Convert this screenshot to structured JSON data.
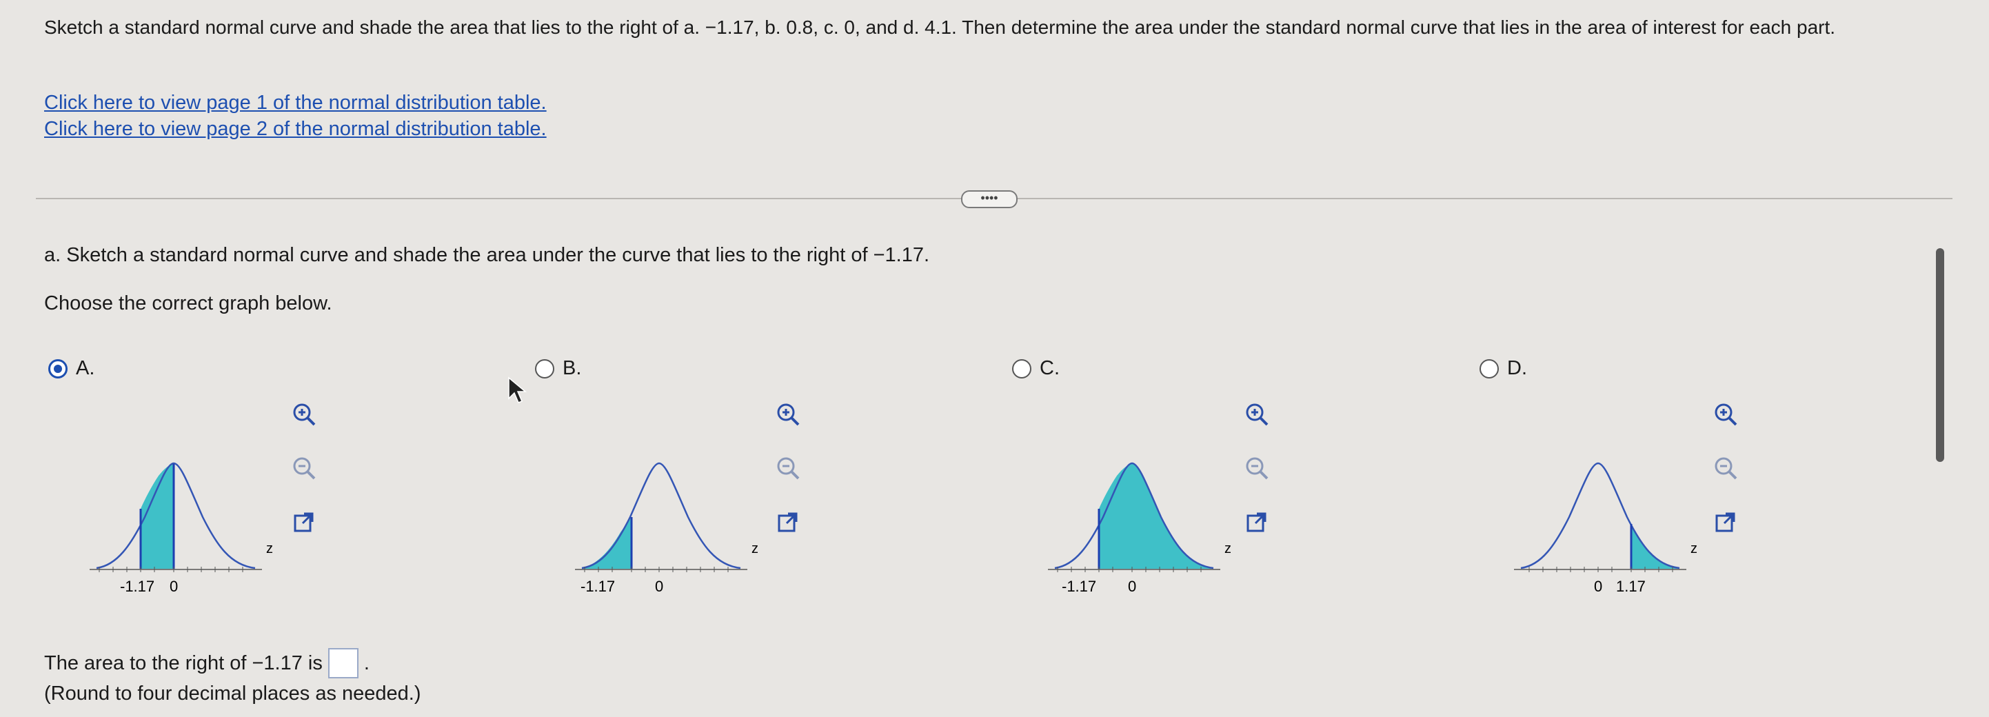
{
  "prompt": "Sketch a standard normal curve and shade the area that lies to the right of a. −1.17, b. 0.8, c. 0, and d. 4.1. Then determine the area under the standard normal curve that lies in the area of interest for each part.",
  "links": [
    "Click here to view page 1 of the normal distribution table.",
    "Click here to view page 2 of the normal distribution table."
  ],
  "more_button": "••••",
  "question": "a. Sketch a standard normal curve and shade the area under the curve that lies to the right of −1.17.",
  "choose": "Choose the correct graph below.",
  "options": [
    {
      "letter": "A.",
      "selected": true,
      "ticks": [
        "-1.17",
        "0"
      ],
      "axis_label": "z"
    },
    {
      "letter": "B.",
      "selected": false,
      "ticks": [
        "-1.17",
        "0"
      ],
      "axis_label": "z"
    },
    {
      "letter": "C.",
      "selected": false,
      "ticks": [
        "-1.17",
        "0"
      ],
      "axis_label": "z"
    },
    {
      "letter": "D.",
      "selected": false,
      "ticks": [
        "0",
        "1.17"
      ],
      "axis_label": "z"
    }
  ],
  "tools": [
    "zoom-in-icon",
    "zoom-out-icon",
    "external-link-icon"
  ],
  "area_prefix": "The area to the right of −1.17 is",
  "area_suffix": ".",
  "answer_value": "",
  "round_note": "(Round to four decimal places as needed.)",
  "colors": {
    "shade": "#3fc0c8",
    "curve": "#3456b5",
    "link": "#1d4fb0"
  }
}
